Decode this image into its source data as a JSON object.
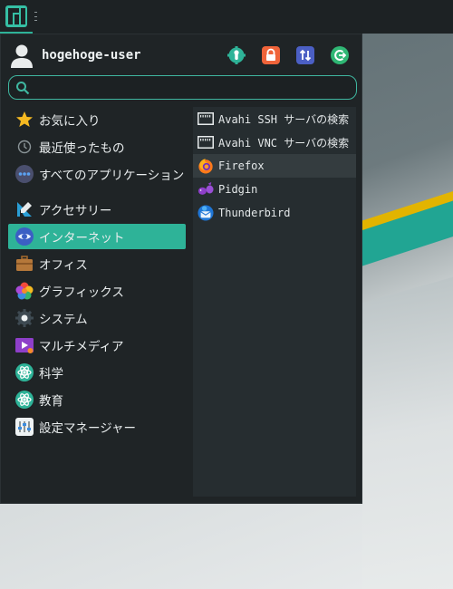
{
  "user": {
    "name": "hogehoge-user"
  },
  "search": {
    "value": "",
    "placeholder": ""
  },
  "actions": [
    {
      "icon": "settings-icon"
    },
    {
      "icon": "lock-icon"
    },
    {
      "icon": "switch-user-icon"
    },
    {
      "icon": "logout-icon"
    }
  ],
  "categories": [
    {
      "label": "お気に入り",
      "icon": "star-icon"
    },
    {
      "label": "最近使ったもの",
      "icon": "clock-icon"
    },
    {
      "label": "すべてのアプリケーション",
      "icon": "all-apps-icon"
    },
    {
      "label": "アクセサリー",
      "icon": "accessories-icon"
    },
    {
      "label": "インターネット",
      "icon": "internet-icon"
    },
    {
      "label": "オフィス",
      "icon": "office-icon"
    },
    {
      "label": "グラフィックス",
      "icon": "graphics-icon"
    },
    {
      "label": "システム",
      "icon": "system-icon"
    },
    {
      "label": "マルチメディア",
      "icon": "multimedia-icon"
    },
    {
      "label": "科学",
      "icon": "science-icon"
    },
    {
      "label": "教育",
      "icon": "education-icon"
    },
    {
      "label": "設定マネージャー",
      "icon": "settings-manager-icon"
    }
  ],
  "apps": [
    {
      "label": "Avahi SSH サーバの検索",
      "icon": "network-icon"
    },
    {
      "label": "Avahi VNC サーバの検索",
      "icon": "network-icon"
    },
    {
      "label": "Firefox",
      "icon": "firefox-icon"
    },
    {
      "label": "Pidgin",
      "icon": "pidgin-icon"
    },
    {
      "label": "Thunderbird",
      "icon": "thunderbird-icon"
    }
  ],
  "colors": {
    "accent": "#2eb398",
    "panel": "#1d2224",
    "menu_bg": "#1f2426",
    "app_pane": "#262d30"
  }
}
